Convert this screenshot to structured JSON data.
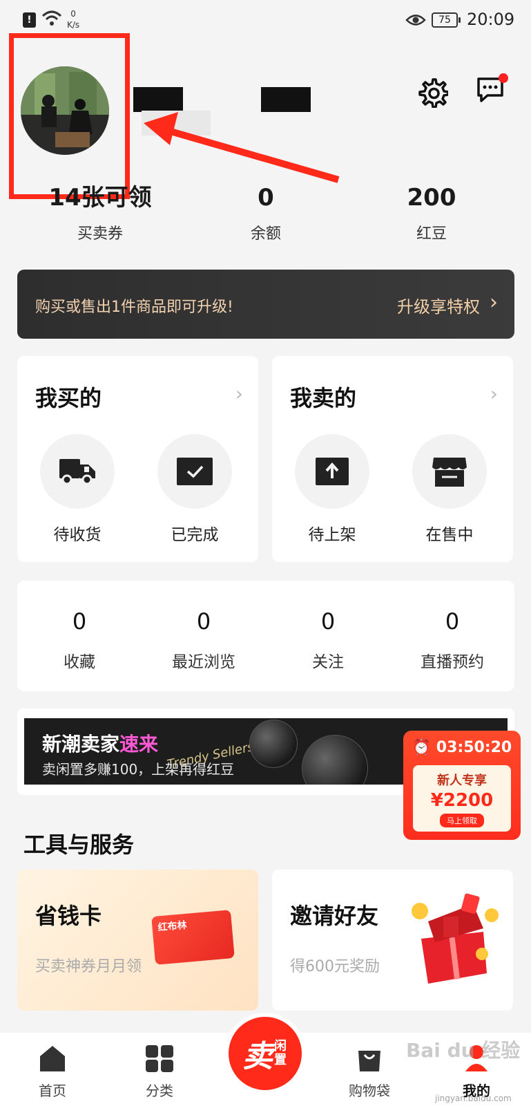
{
  "status": {
    "speed_value": "0",
    "speed_unit": "K/s",
    "battery": "75",
    "time": "20:09"
  },
  "stats_top": [
    {
      "value": "14张可领",
      "label": "买卖券"
    },
    {
      "value": "0",
      "label": "余额"
    },
    {
      "value": "200",
      "label": "红豆"
    }
  ],
  "upgrade": {
    "text": "购买或售出1件商品即可升级!",
    "cta": "升级享特权"
  },
  "buy": {
    "title": "我买的",
    "items": [
      {
        "label": "待收货",
        "icon": "truck-icon"
      },
      {
        "label": "已完成",
        "icon": "check-box-icon"
      }
    ]
  },
  "sell": {
    "title": "我卖的",
    "items": [
      {
        "label": "待上架",
        "icon": "upload-icon"
      },
      {
        "label": "在售中",
        "icon": "store-icon"
      }
    ]
  },
  "stats_bottom": [
    {
      "value": "0",
      "label": "收藏"
    },
    {
      "value": "0",
      "label": "最近浏览"
    },
    {
      "value": "0",
      "label": "关注"
    },
    {
      "value": "0",
      "label": "直播预约"
    }
  ],
  "promo": {
    "title_prefix": "新潮卖家",
    "title_highlight": "速来",
    "script": "Trendy Sellers",
    "subtitle": "卖闲置多赚100，上架再得红豆"
  },
  "coupon": {
    "timer": "03:50:20",
    "label": "新人专享",
    "amount": "¥2200",
    "button": "马上领取"
  },
  "tools": {
    "section_title": "工具与服务",
    "save_card": {
      "title": "省钱卡",
      "subtitle": "买卖神券月月领",
      "card_text": "红布林"
    },
    "invite": {
      "title": "邀请好友",
      "subtitle": "得600元奖励"
    }
  },
  "nav": {
    "home": "首页",
    "category": "分类",
    "sell_big": "卖",
    "sell_small": "闲置",
    "bag": "购物袋",
    "mine": "我的"
  },
  "watermark": "Bai du 经验",
  "watermark_url": "jingyan.baidu.com",
  "colors": {
    "accent": "#ff2a1a",
    "gold": "#f2cfa8",
    "highlight": "#ff59d6"
  }
}
